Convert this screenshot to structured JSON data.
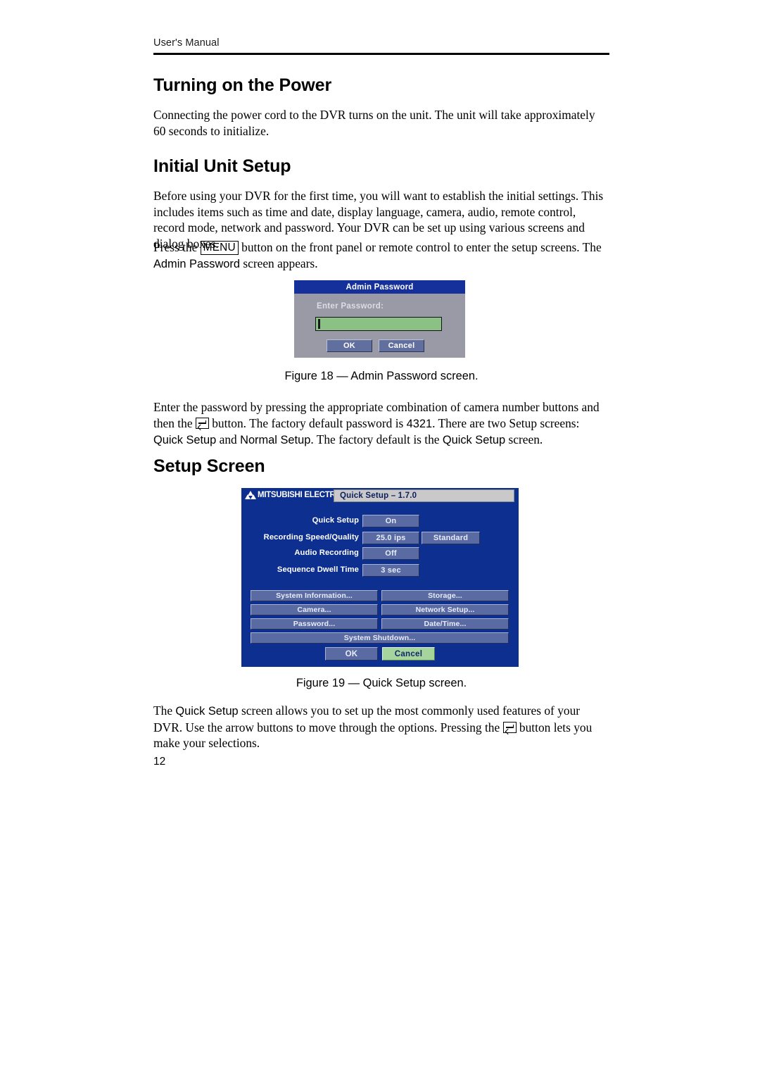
{
  "header": {
    "running_title": "User's Manual"
  },
  "headings": {
    "turning_on_power": "Turning on the Power",
    "initial_unit_setup": "Initial Unit Setup",
    "setup_screen": "Setup Screen"
  },
  "paragraphs": {
    "power": "Connecting the power cord to the DVR turns on the unit.  The unit will take approximately 60 seconds to initialize.",
    "initial": "Before using your DVR for the first time, you will want to establish the initial settings.  This includes items such as time and date, display language, camera, audio, remote control, record mode, network and password.  Your DVR can be set up using various screens and dialog boxes.",
    "menu_before_key": "Press the ",
    "menu_key": "MENU",
    "menu_after_key": " button on the front panel or remote control to enter the setup screens.  The ",
    "menu_admin_password": "Admin Password",
    "menu_tail": " screen appears.",
    "enter_part1": "Enter the password by pressing the appropriate combination of camera number buttons and then the ",
    "enter_part2": " button.  The factory default password is ",
    "enter_default_password": "4321",
    "enter_part3": ".  There are two Setup screens: ",
    "enter_quick_setup": "Quick Setup",
    "enter_part4": " and ",
    "enter_normal_setup": "Normal Setup",
    "enter_part5": ".  The factory default is the ",
    "enter_quick_setup_2": "Quick Setup",
    "enter_part6": " screen.",
    "quick_part1": "The ",
    "quick_label": "Quick Setup",
    "quick_part2": " screen allows you to set up the most commonly used features of your DVR.  Use the arrow buttons to move through the options.  Pressing the ",
    "quick_part3": " button lets you make your selections."
  },
  "captions": {
    "figure_18": "Figure 18 — Admin Password screen.",
    "figure_19": "Figure 19 — Quick Setup screen."
  },
  "page_number": "12",
  "admin_password_dialog": {
    "title": "Admin Password",
    "field_label": "Enter Password:",
    "field_value": "",
    "ok_label": "OK",
    "cancel_label": "Cancel",
    "colors": {
      "titlebar": "#16309b",
      "body": "#9a9aa6",
      "input": "#8cc185",
      "button": "#606f9e"
    }
  },
  "quick_setup_screen": {
    "brand": "MITSUBISHI ELECTRIC",
    "title": "Quick Setup – 1.7.0",
    "settings": [
      {
        "label": "Quick Setup",
        "value1": "On",
        "value2": null
      },
      {
        "label": "Recording Speed/Quality",
        "value1": "25.0 ips",
        "value2": "Standard"
      },
      {
        "label": "Audio Recording",
        "value1": "Off",
        "value2": null
      },
      {
        "label": "Sequence Dwell Time",
        "value1": "3 sec",
        "value2": null
      }
    ],
    "menu_buttons": [
      [
        "System Information...",
        "Storage..."
      ],
      [
        "Camera...",
        "Network Setup..."
      ],
      [
        "Password...",
        "Date/Time..."
      ]
    ],
    "shutdown_button": "System Shutdown...",
    "ok_label": "OK",
    "cancel_label": "Cancel",
    "colors": {
      "background": "#0d2f8f",
      "titlebar": "#c9c9c9",
      "button": "#5a6ba3",
      "cancel_highlight": "#a5d49c"
    }
  }
}
